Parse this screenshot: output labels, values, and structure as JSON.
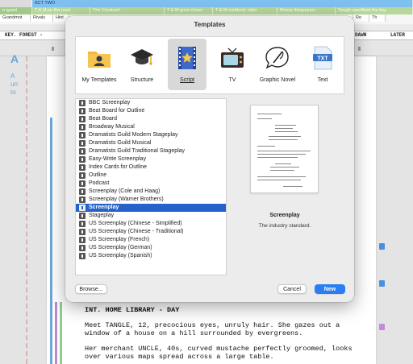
{
  "timeline": {
    "act": [
      "ACT TWO"
    ],
    "scenes": [
      "n quest",
      "T & M on the road",
      "The Creature!",
      "T & M grow closer",
      "T & M suddenly older",
      "Mossy disappears",
      "Tangle sacrifices the key"
    ],
    "characters": [
      "Grandmot",
      "Rivals",
      "Hint",
      "Re",
      "Th"
    ]
  },
  "scene_strip": {
    "left": "KEY. FOREST -",
    "right_1": "DAWN",
    "right_2": "LATER"
  },
  "left_panel": {
    "title": "A",
    "text": "A un to"
  },
  "dialog": {
    "title": "Templates",
    "categories": [
      {
        "label": "My Templates",
        "icon": "folder-person-icon"
      },
      {
        "label": "Structure",
        "icon": "graduation-cap-icon"
      },
      {
        "label": "Script",
        "icon": "film-star-icon"
      },
      {
        "label": "TV",
        "icon": "television-icon"
      },
      {
        "label": "Graphic Novel",
        "icon": "quill-icon"
      },
      {
        "label": "Text",
        "icon": "txt-file-icon"
      }
    ],
    "selected_category": "Script",
    "templates": [
      "BBC Screenplay",
      "Beat Board for Outline",
      "Beat Board",
      "Broadway Musical",
      "Dramatists Guild Modern Stageplay",
      "Dramatists Guild Musical",
      "Dramatists Guild Traditional Stageplay",
      "Easy-Write Screenplay",
      "Index Cards for Outline",
      "Outline",
      "Podcast",
      "Screenplay (Cole and Haag)",
      "Screenplay (Warner Brothers)",
      "Screenplay",
      "Stageplay",
      "US Screenplay (Chinese - Simplified)",
      "US Screenplay (Chinese - Traditional)",
      "US Screenplay (French)",
      "US Screenplay (German)",
      "US Screenplay (Spanish)"
    ],
    "selected_template": "Screenplay",
    "preview_title": "Screenplay",
    "preview_description": "The industry standard.",
    "browse_label": "Browse...",
    "cancel_label": "Cancel",
    "new_label": "New",
    "accent_color": "#2563c8"
  },
  "screenplay": {
    "heading": "INT. HOME LIBRARY - DAY",
    "action_1": "Meet TANGLE, 12, precocious eyes, unruly hair. She gazes out a window of a house on a hill surrounded by evergreens.",
    "action_2": "Her merchant UNCLE, 40s, curved mustache perfectly groomed, looks over various maps spread across a large table."
  }
}
